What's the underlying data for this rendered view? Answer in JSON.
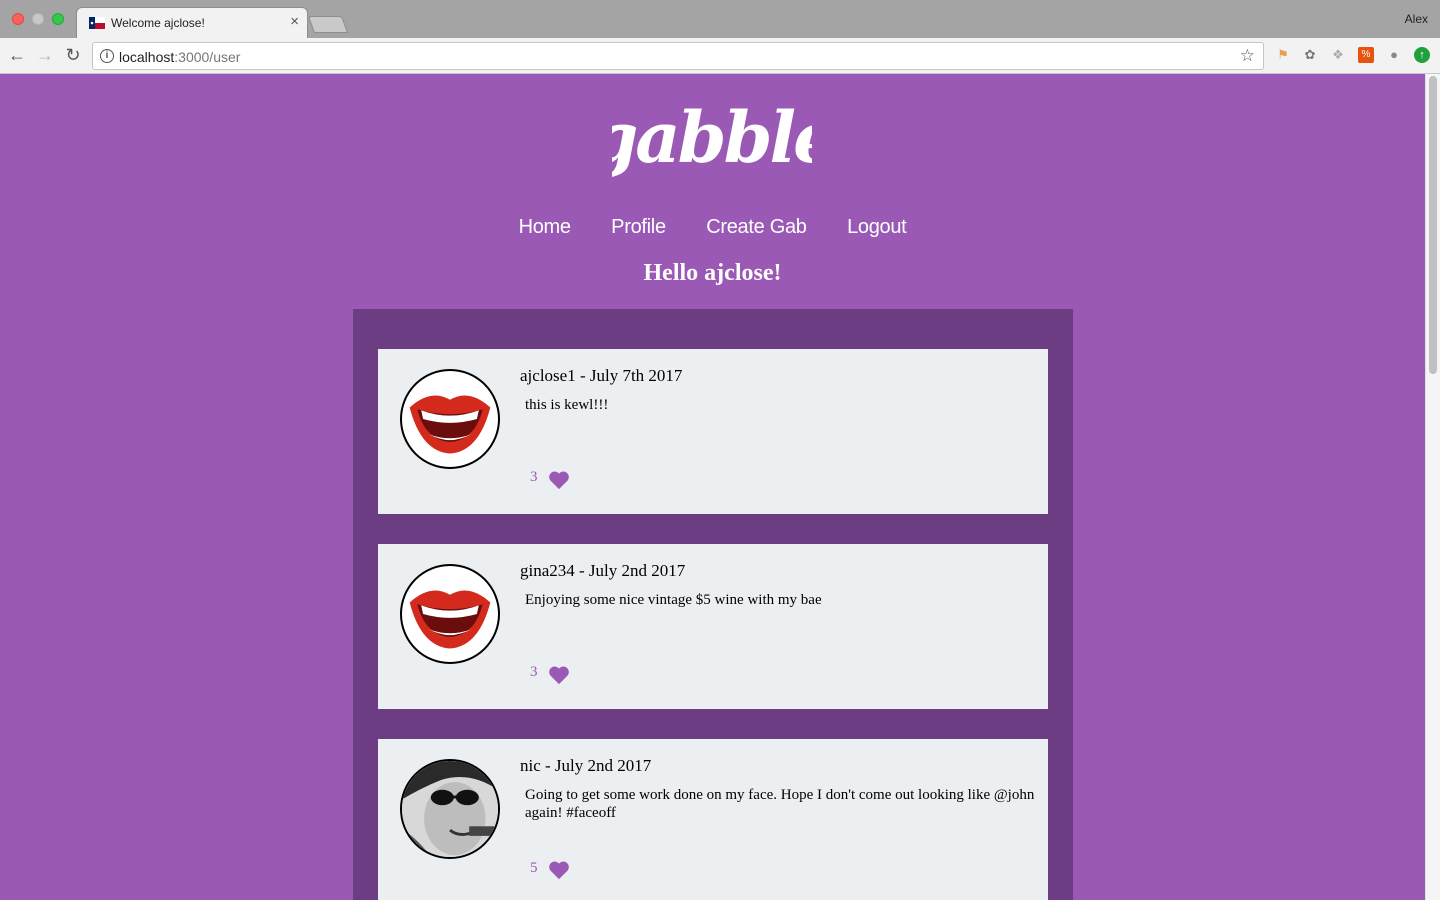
{
  "browser": {
    "tab_title": "Welcome ajclose!",
    "tab_close": "×",
    "user": "Alex",
    "url_host": "localhost",
    "url_path": ":3000/user"
  },
  "site": {
    "logo_text": "gabble",
    "nav": [
      {
        "label": "Home"
      },
      {
        "label": "Profile"
      },
      {
        "label": "Create Gab"
      },
      {
        "label": "Logout"
      }
    ],
    "greeting": "Hello ajclose!"
  },
  "gabs": [
    {
      "author_line": "ajclose1 - July 7th 2017",
      "text": "this is kewl!!!",
      "likes": "3",
      "avatar": "lips-icon"
    },
    {
      "author_line": "gina234 - July 2nd 2017",
      "text": "Enjoying some nice vintage $5 wine with my bae",
      "likes": "3",
      "avatar": "lips-icon"
    },
    {
      "author_line": "nic - July 2nd 2017",
      "text": "Going to get some work done on my face. Hope I don't come out looking like @john again! #faceoff",
      "likes": "5",
      "avatar": "photo-avatar"
    }
  ],
  "colors": {
    "page_bg": "#9b59b6",
    "feed_bg": "#6c3d82",
    "card_bg": "#eceff1",
    "accent": "#9b59b6"
  }
}
